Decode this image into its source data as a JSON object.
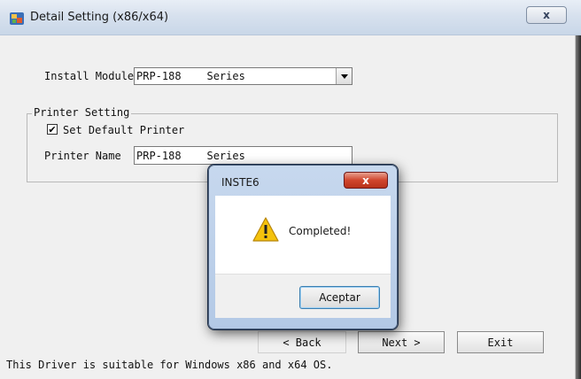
{
  "window": {
    "title": "Detail Setting (x86/x64)",
    "close_glyph": "x"
  },
  "install": {
    "label": "Install Module",
    "selected": "PRP-188    Series"
  },
  "printer_setting": {
    "legend": "Printer Setting",
    "set_default_label": "Set Default Printer",
    "set_default_checked": true,
    "printer_name_label": "Printer Name",
    "printer_name_value": "PRP-188    Series"
  },
  "buttons": {
    "back": "< Back",
    "next": "Next >",
    "exit": "Exit"
  },
  "footer": "This Driver is suitable for Windows x86 and x64 OS.",
  "dialog": {
    "title": "INSTE6",
    "message": "Completed!",
    "ok": "Aceptar",
    "close_glyph": "x"
  },
  "colors": {
    "titlebar": "#d7e1ee",
    "client_bg": "#f0f0f0",
    "dialog_close": "#d0462d",
    "warning_yellow": "#f4c20d"
  },
  "icons": {
    "app": "printer-app-icon",
    "dialog": "warning-icon"
  }
}
